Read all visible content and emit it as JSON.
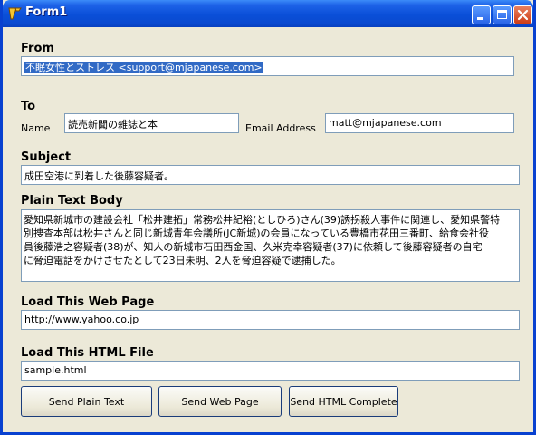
{
  "window": {
    "title": "Form1"
  },
  "from": {
    "heading": "From",
    "value": "不眠女性とストレス <support@mjapanese.com>"
  },
  "to": {
    "heading": "To",
    "name_label": "Name",
    "name_value": "読売新聞の雑誌と本",
    "email_label": "Email Address",
    "email_value": "matt@mjapanese.com"
  },
  "subject": {
    "heading": "Subject",
    "value": "成田空港に到着した後藤容疑者。"
  },
  "plain_text_body": {
    "heading": "Plain Text Body",
    "lines": [
      "愛知県新城市の建設会社「松井建拓」常務松井紀裕(としひろ)さん(39)誘拐殺人事件に関連し、愛知県警特",
      "別捜査本部は松井さんと同じ新城青年会議所(JC新城)の会員になっている豊橋市花田三番町、給食会社役",
      "員後藤浩之容疑者(38)が、知人の新城市石田西金国、久米克幸容疑者(37)に依頼して後藤容疑者の自宅",
      "に脅迫電話をかけさせたとして23日未明、2人を脅迫容疑で逮捕した。"
    ]
  },
  "web_page": {
    "heading": "Load This Web Page",
    "value": "http://www.yahoo.co.jp"
  },
  "html_file": {
    "heading": "Load This HTML File",
    "value": "sample.html"
  },
  "buttons": {
    "send_plain": "Send Plain Text",
    "send_web": "Send Web Page",
    "send_html": "Send HTML Complete"
  },
  "colors": {
    "titlebar": "#0a4fd8",
    "selection": "#316ac5",
    "close_button": "#cd3c16",
    "dialog_bg": "#ece9d8"
  },
  "icons": {
    "app": "delphi-7-icon",
    "minimize": "minimize-icon",
    "maximize": "maximize-icon",
    "close": "close-icon"
  }
}
